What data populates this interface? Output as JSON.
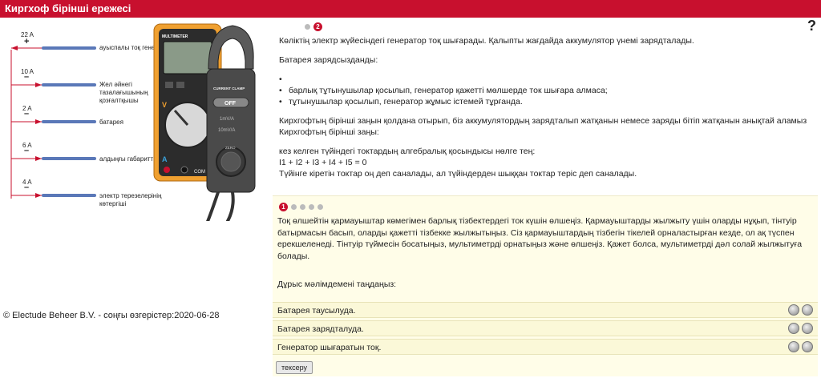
{
  "window": {
    "title": "Киргхоф бірінші ережесі"
  },
  "circuit": {
    "branches": [
      {
        "current": "22 A",
        "sign": "+",
        "label": "ауыспалы тоқ генер"
      },
      {
        "current": "10 A",
        "sign": "–",
        "label": "Жел әйнегі тазалағышының қозғалтқышы"
      },
      {
        "current": "2 A",
        "sign": "–",
        "label": "батарея"
      },
      {
        "current": "6 A",
        "sign": "–",
        "label": "алдыңғы габаритті"
      },
      {
        "current": "4 A",
        "sign": "–",
        "label": "электр терезелерінің көтергіші"
      }
    ]
  },
  "multimeter": {
    "brand": "MULTIMETER",
    "clamp_title": "CURRENT CLAMP",
    "off": "OFF",
    "range1": "1mV/A",
    "range2": "10mV/A",
    "zero": "ZERO",
    "v_label": "V",
    "a_label": "A",
    "com": "COM"
  },
  "footer": {
    "copyright": "© Electude Beheer B.V. - соңғы өзгерістер:2020-06-28"
  },
  "pager": {
    "current": "2"
  },
  "help": {
    "label": "?"
  },
  "info": {
    "p1": "Көліктің электр жүйесіндегі генератор тоқ шығарады. Қалыпты жағдайда аккумулятор үнемі зарядталады.",
    "p2": "Батарея зарядсызданды:",
    "bullets": [
      "",
      "барлық тұтынушылар қосылып, генератор қажетті мөлшерде ток шығара алмаса;",
      "тұтынушылар қосылып, генератор жұмыс істемей тұрғанда."
    ],
    "p3": "Кирхгофтың бірінші заңын қолдана отырып, біз аккумулятордың зарядталып жатқанын немесе заряды бітіп жатқанын анықтай аламыз Кирхгофтың бірінші заңы:",
    "p4_line1": "кез келген түйіндегі токтардың алгебралық қосындысы нөлге тең:",
    "p4_line2": "I1 + I2 + I3 + I4 + I5 = 0",
    "p4_line3": "Түйінге кіретін токтар оң деп саналады, ал түйіндерден шыққан токтар теріс деп саналады."
  },
  "question": {
    "number": "1",
    "text": "Тоқ өлшейтін қармауыштар көмегімен барлық тізбектердегі ток күшін өлшеңіз. Қармауыштарды жылжыту үшін оларды нұқып, тінтуір батырмасын басып, оларды қажетті тізбекке жылжытыңыз. Сіз қармауыштардың тізбегін тікелей орналастырған кезде, ол ақ түспен ерекшеленеді. Тінтуір түймесін босатыңыз, мультиметрді орнатыңыз және өлшеңіз. Қажет болса, мультиметрді дәл солай жылжытуға болады.",
    "prompt": "Дұрыс мәлімдемені таңдаңыз:",
    "answers": [
      "Батарея таусылуда.",
      "Батарея зарядталуда.",
      "Генератор шығаратын тоқ."
    ],
    "check_label": "тексеру"
  },
  "colors": {
    "accent": "#c8102e",
    "wire": "#5a78b8",
    "meter_body": "#f0a030"
  }
}
